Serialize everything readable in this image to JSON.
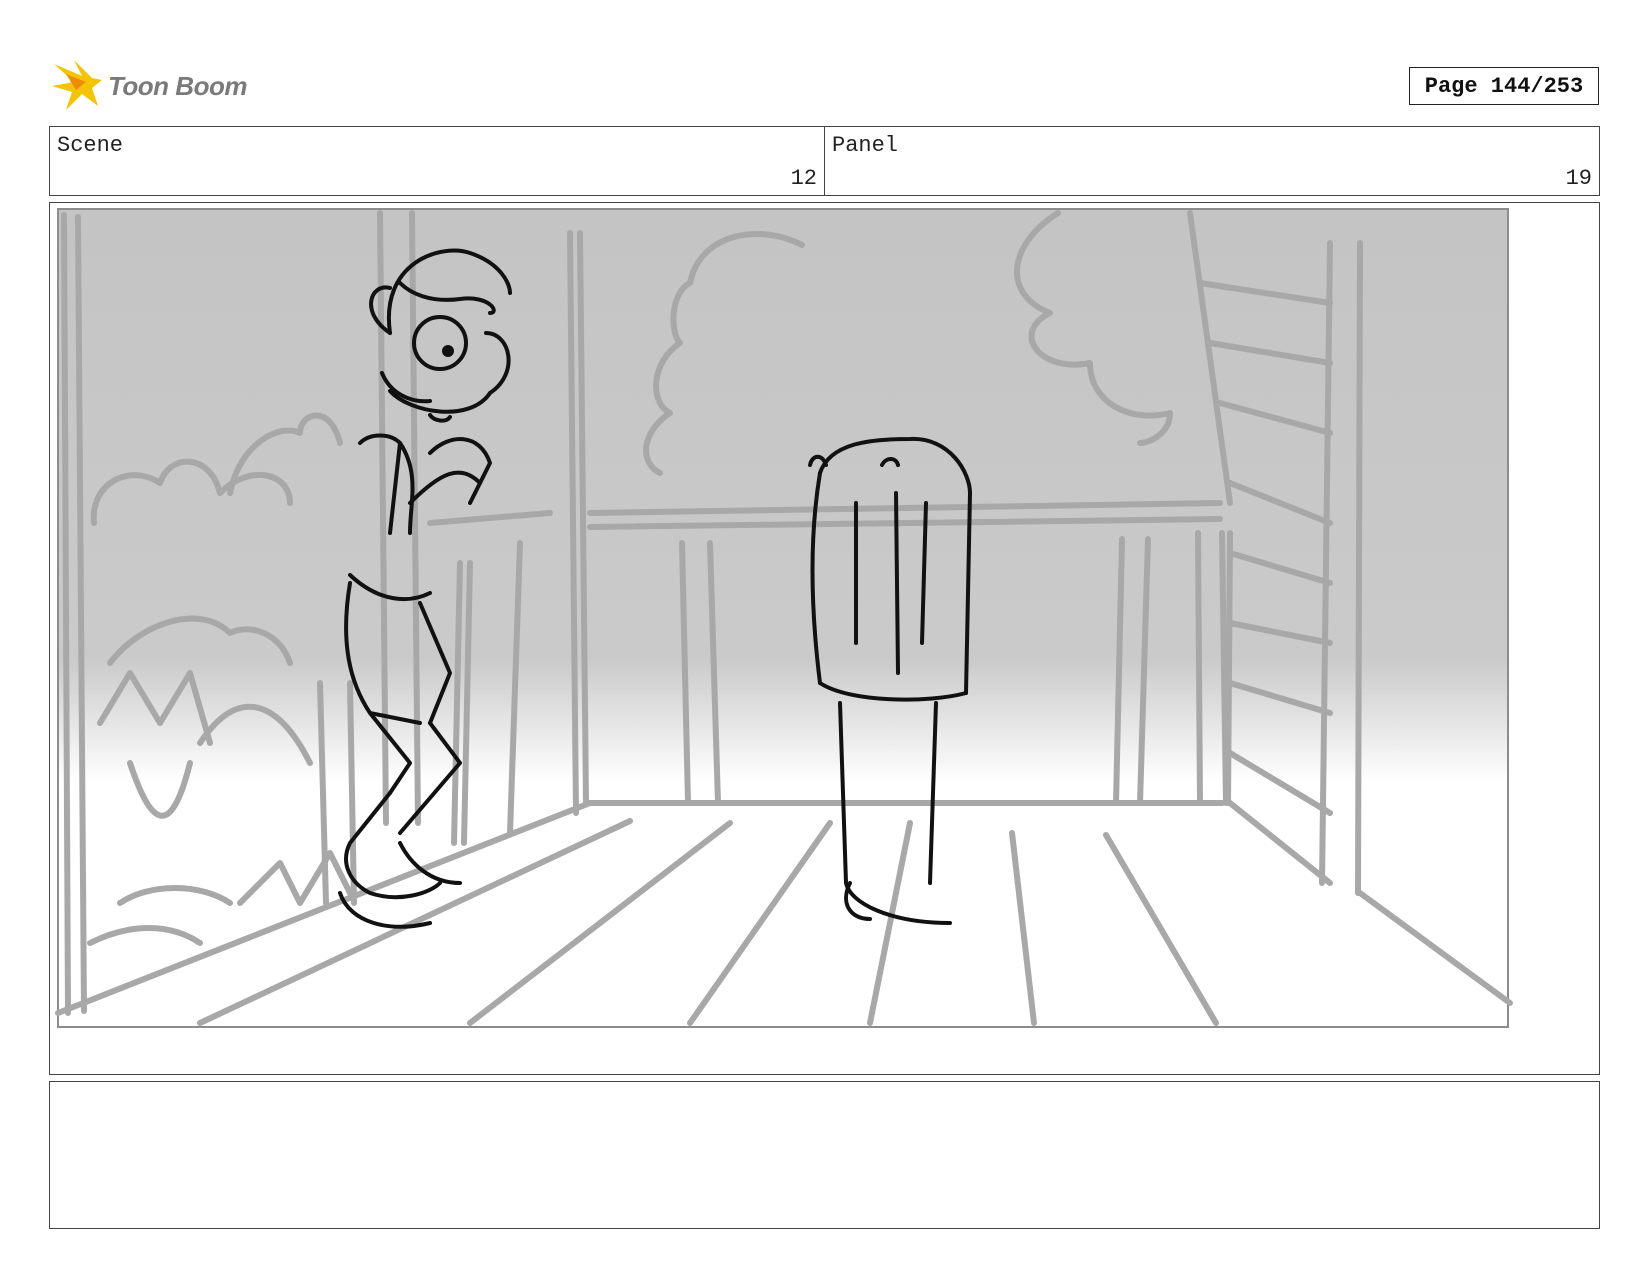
{
  "logo": {
    "text": "Toon Boom",
    "icon": "toon-boom-star-icon",
    "accent": "#f5b800"
  },
  "page": {
    "label": "Page 144/253"
  },
  "header": {
    "scene_label": "Scene",
    "scene_value": "12",
    "panel_label": "Panel",
    "panel_value": "19"
  },
  "notes": {
    "text": ""
  },
  "colors": {
    "sketch_gray": "#a9a9a9",
    "sketch_black": "#111111",
    "bg_gray": "#c8c8c8"
  }
}
